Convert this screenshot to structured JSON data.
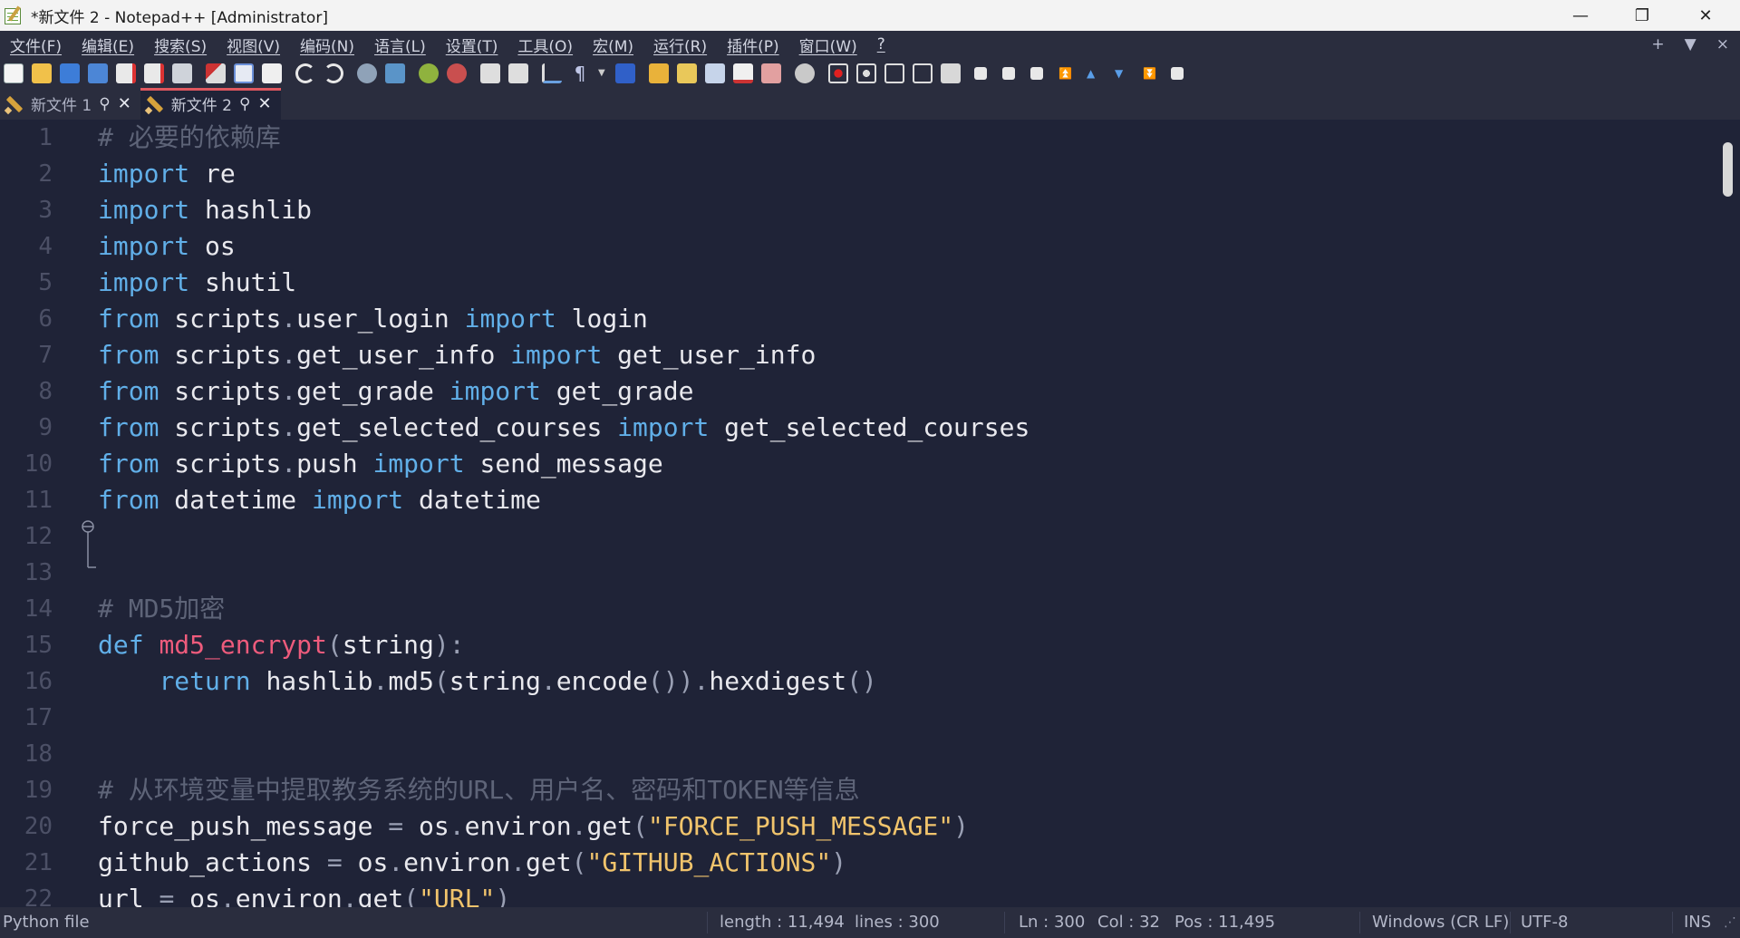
{
  "window": {
    "title": "*新文件 2 - Notepad++ [Administrator]",
    "minimize": "—",
    "maximize": "❐",
    "close": "✕"
  },
  "menu": [
    "文件(F)",
    "编辑(E)",
    "搜索(S)",
    "视图(V)",
    "编码(N)",
    "语言(L)",
    "设置(T)",
    "工具(O)",
    "宏(M)",
    "运行(R)",
    "插件(P)",
    "窗口(W)",
    "?"
  ],
  "menu_right": {
    "add": "+",
    "dropdown": "▼",
    "close": "×"
  },
  "tabs": [
    {
      "label": "新文件 1",
      "active": false
    },
    {
      "label": "新文件 2",
      "active": true
    }
  ],
  "tab_pin": "⚲",
  "tab_close": "✕",
  "editor": {
    "line_numbers": [
      "1",
      "2",
      "3",
      "4",
      "5",
      "6",
      "7",
      "8",
      "9",
      "10",
      "11",
      "12",
      "13",
      "14",
      "15",
      "16",
      "17",
      "18",
      "19",
      "20",
      "21",
      "22"
    ],
    "lines": [
      [
        [
          "cm",
          "# 必要的依赖库"
        ]
      ],
      [
        [
          "kw",
          "import"
        ],
        [
          "tx",
          " re"
        ]
      ],
      [
        [
          "kw",
          "import"
        ],
        [
          "tx",
          " hashlib"
        ]
      ],
      [
        [
          "kw",
          "import"
        ],
        [
          "tx",
          " os"
        ]
      ],
      [
        [
          "kw",
          "import"
        ],
        [
          "tx",
          " shutil"
        ]
      ],
      [
        [
          "kw",
          "from"
        ],
        [
          "tx",
          " scripts"
        ],
        [
          "op",
          "."
        ],
        [
          "tx",
          "user_login "
        ],
        [
          "kw",
          "import"
        ],
        [
          "tx",
          " login"
        ]
      ],
      [
        [
          "kw",
          "from"
        ],
        [
          "tx",
          " scripts"
        ],
        [
          "op",
          "."
        ],
        [
          "tx",
          "get_user_info "
        ],
        [
          "kw",
          "import"
        ],
        [
          "tx",
          " get_user_info"
        ]
      ],
      [
        [
          "kw",
          "from"
        ],
        [
          "tx",
          " scripts"
        ],
        [
          "op",
          "."
        ],
        [
          "tx",
          "get_grade "
        ],
        [
          "kw",
          "import"
        ],
        [
          "tx",
          " get_grade"
        ]
      ],
      [
        [
          "kw",
          "from"
        ],
        [
          "tx",
          " scripts"
        ],
        [
          "op",
          "."
        ],
        [
          "tx",
          "get_selected_courses "
        ],
        [
          "kw",
          "import"
        ],
        [
          "tx",
          " get_selected_courses"
        ]
      ],
      [
        [
          "kw",
          "from"
        ],
        [
          "tx",
          " scripts"
        ],
        [
          "op",
          "."
        ],
        [
          "tx",
          "push "
        ],
        [
          "kw",
          "import"
        ],
        [
          "tx",
          " send_message"
        ]
      ],
      [
        [
          "kw",
          "from"
        ],
        [
          "tx",
          " datetime "
        ],
        [
          "kw",
          "import"
        ],
        [
          "tx",
          " datetime"
        ]
      ],
      [],
      [],
      [
        [
          "cm",
          "# MD5加密"
        ]
      ],
      [
        [
          "kw",
          "def"
        ],
        [
          "tx",
          " "
        ],
        [
          "fn",
          "md5_encrypt"
        ],
        [
          "op",
          "("
        ],
        [
          "tx",
          "string"
        ],
        [
          "op",
          "):"
        ]
      ],
      [
        [
          "tx",
          "    "
        ],
        [
          "kw",
          "return"
        ],
        [
          "tx",
          " hashlib"
        ],
        [
          "op",
          "."
        ],
        [
          "tx",
          "md5"
        ],
        [
          "op",
          "("
        ],
        [
          "tx",
          "string"
        ],
        [
          "op",
          "."
        ],
        [
          "tx",
          "encode"
        ],
        [
          "op",
          "())."
        ],
        [
          "tx",
          "hexdigest"
        ],
        [
          "op",
          "()"
        ]
      ],
      [],
      [],
      [
        [
          "cm",
          "# 从环境变量中提取教务系统的URL、用户名、密码和TOKEN等信息"
        ]
      ],
      [
        [
          "tx",
          "force_push_message "
        ],
        [
          "op",
          "="
        ],
        [
          "tx",
          " os"
        ],
        [
          "op",
          "."
        ],
        [
          "tx",
          "environ"
        ],
        [
          "op",
          "."
        ],
        [
          "tx",
          "get"
        ],
        [
          "op",
          "("
        ],
        [
          "str",
          "\"FORCE_PUSH_MESSAGE\""
        ],
        [
          "op",
          ")"
        ]
      ],
      [
        [
          "tx",
          "github_actions "
        ],
        [
          "op",
          "="
        ],
        [
          "tx",
          " os"
        ],
        [
          "op",
          "."
        ],
        [
          "tx",
          "environ"
        ],
        [
          "op",
          "."
        ],
        [
          "tx",
          "get"
        ],
        [
          "op",
          "("
        ],
        [
          "str",
          "\"GITHUB_ACTIONS\""
        ],
        [
          "op",
          ")"
        ]
      ],
      [
        [
          "tx",
          "url "
        ],
        [
          "op",
          "="
        ],
        [
          "tx",
          " os"
        ],
        [
          "op",
          "."
        ],
        [
          "tx",
          "environ"
        ],
        [
          "op",
          "."
        ],
        [
          "tx",
          "get"
        ],
        [
          "op",
          "("
        ],
        [
          "str",
          "\"URL\""
        ],
        [
          "op",
          ")"
        ]
      ]
    ]
  },
  "status": {
    "file_type": "Python file",
    "length": "length : 11,494",
    "lines": "lines : 300",
    "ln": "Ln : 300",
    "col": "Col : 32",
    "pos": "Pos : 11,495",
    "eol": "Windows (CR LF)",
    "encoding": "UTF-8",
    "mode": "INS"
  },
  "colors": {
    "background": "#1f2337",
    "comment": "#5e6478",
    "keyword": "#61afe8",
    "function": "#ee5b7c",
    "string": "#f1c46c",
    "active_tab_accent": "#e0585f"
  }
}
